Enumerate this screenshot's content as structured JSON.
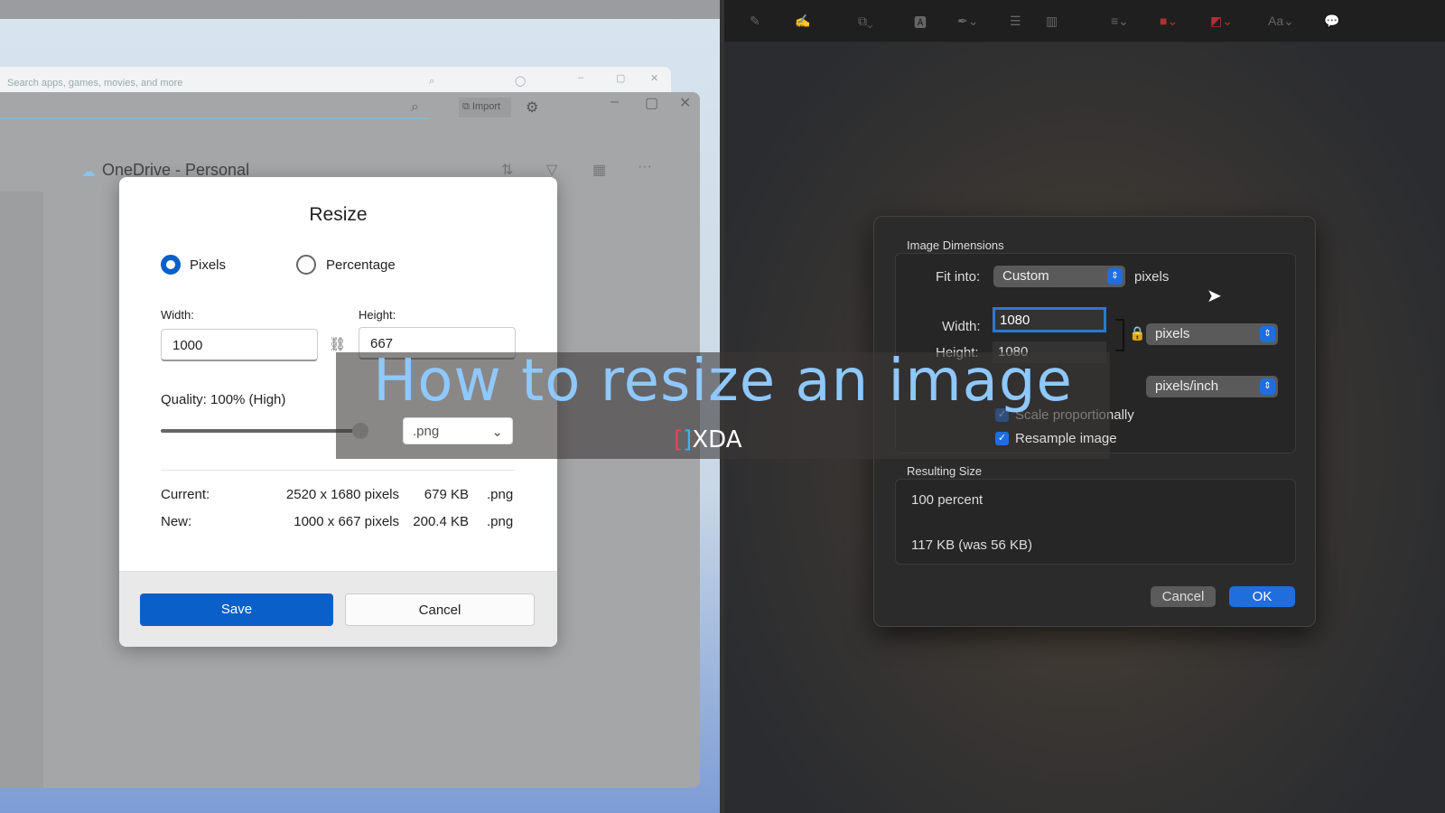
{
  "store": {
    "search_placeholder": "Search apps, games, movies, and more"
  },
  "photos": {
    "import_label": "Import",
    "location": "OneDrive - Personal"
  },
  "resize_dialog": {
    "title": "Resize",
    "mode_pixels": "Pixels",
    "mode_percentage": "Percentage",
    "width_label": "Width:",
    "height_label": "Height:",
    "width_value": "1000",
    "height_value": "667",
    "quality_label": "Quality: 100% (High)",
    "quality_percent": 100,
    "format_value": ".png",
    "current_label": "Current:",
    "current_dims": "2520 x 1680 pixels",
    "current_size": "679 KB",
    "current_ext": ".png",
    "new_label": "New:",
    "new_dims": "1000 x 667 pixels",
    "new_size": "200.4 KB",
    "new_ext": ".png",
    "save_label": "Save",
    "cancel_label": "Cancel"
  },
  "mac_dialog": {
    "section_dimensions": "Image Dimensions",
    "fit_into_label": "Fit into:",
    "fit_into_value": "Custom",
    "fit_units": "pixels",
    "width_label": "Width:",
    "width_value": "1080",
    "height_label": "Height:",
    "height_value": "1080",
    "size_unit": "pixels",
    "resolution_unit": "pixels/inch",
    "scale_label": "Scale proportionally",
    "resample_label": "Resample image",
    "section_result": "Resulting Size",
    "result_percent": "100 percent",
    "result_size": "117 KB (was 56 KB)",
    "cancel_label": "Cancel",
    "ok_label": "OK"
  },
  "overlay": {
    "title": "How to resize an image",
    "logo": "XDA"
  },
  "colors": {
    "accent_win": "#0a5fc8",
    "accent_mac": "#1f6ee0",
    "title": "#8ec8ff"
  }
}
